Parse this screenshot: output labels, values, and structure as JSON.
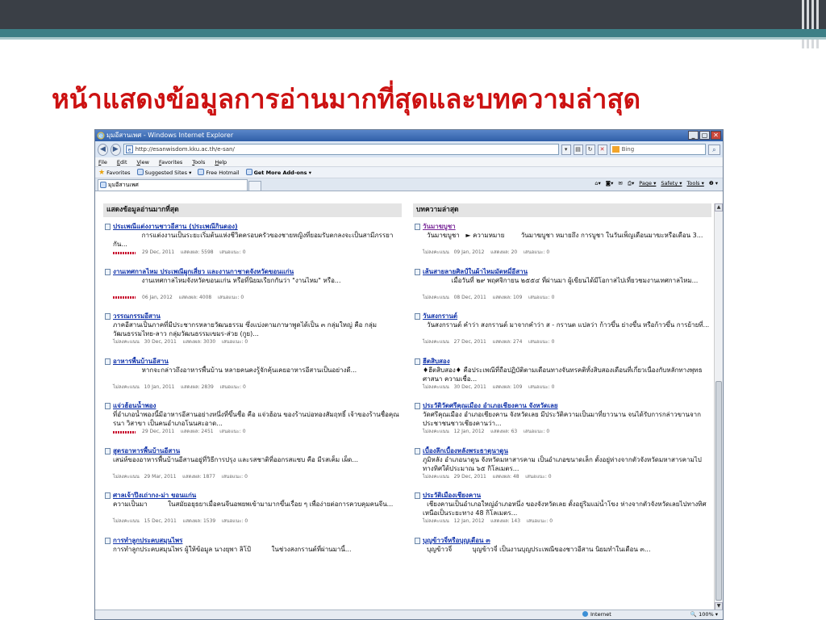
{
  "slide": {
    "title": "หน้าแสดงข้อมูลการอ่านมากที่สุดและบทความล่าสุด",
    "title_color": "#cc1111",
    "accent": "#3d7f86"
  },
  "browser": {
    "window_title": "มุมอีสานเพศ - Windows Internet Explorer",
    "address": "http://esanwisdom.kku.ac.th/e-san/",
    "search_placeholder": "Bing",
    "nav_back": "◀",
    "nav_forward": "▶",
    "menu": [
      "File",
      "Edit",
      "View",
      "Favorites",
      "Tools",
      "Help"
    ],
    "favorites": {
      "label": "Favorites",
      "suggested": "Suggested Sites ▾",
      "hotmail": "Free Hotmail",
      "addons": "Get More Add-ons ▾"
    },
    "tab_label": "มุมอีสานเพศ",
    "commands": {
      "page": "Page ▾",
      "safety": "Safety ▾",
      "tools": "Tools ▾",
      "help": "❷ ▾"
    },
    "status": {
      "zone": "Internet",
      "zoom": "100%"
    }
  },
  "left": {
    "header": "แสดงข้อมูลอ่านมากที่สุด",
    "items": [
      {
        "title": "ประเพณีแต่งงานชาวอีสาน (ประเพณีกินดอง)",
        "text": "              การแต่งงานเป็นระยะเริ่มต้นแห่งชีวิตครอบครัวของชายหญิงที่ยอมรับตกลงจะเป็นสามีภรรยากัน...",
        "meta": "29 Dec, 2011    แสดงผล: 5598    เสนอแนะ: 0",
        "rating": true
      },
      {
        "title": "งานเทศกาลไหม ประเพณีผูกเสี่ยว และงานกาชาดจังหวัดขอนแก่น",
        "text": "              งานเทศกาลไหมจังหวัดขอนแก่น หรือที่นิยมเรียกกันว่า \"งานไหม\" หรือ...",
        "meta": "06 Jan, 2012    แสดงผล: 4008    เสนอแนะ: 0",
        "rating": true
      },
      {
        "title": "วรรณกรรมอีสาน",
        "text": "ภาคอีสานเป็นภาคที่มีประชากรหลายวัฒนธรรม ซึ่งแบ่งตามภาษาพูดได้เป็น ๓ กลุ่มใหญ่ คือ กลุ่มวัฒนธรรมไทย-ลาว กลุ่มวัฒนธรรมเขมร-ส่วย (กูย)...",
        "meta": "ไม่ลงคะแนน   30 Dec, 2011    แสดงผล: 3030    เสนอแนะ: 0",
        "rating": false
      },
      {
        "title": "อาหารพื้นบ้านอีสาน",
        "text": "              หากจะกล่าวถึงอาหารพื้นบ้าน หลายคนคงรู้จักคุ้นเคยอาหารอีสานเป็นอย่างดี...",
        "meta": "ไม่ลงคะแนน   10 Jan, 2011    แสดงผล: 2839    เสนอแนะ: 0",
        "rating": false
      },
      {
        "title": "แจ่วฮ้อนน้ำพอง",
        "text": "ที่อำเภอน้ำพองนี้มีอาหารอีสานอย่างหนึ่งที่ขึ้นชื่อ คือ แจ่วฮ้อน ของร้านบ่อทองสัมฤทธิ์ เจ้าของร้านชื่อคุณรนา วิสาขา เป็นคนอำเภอโนนสะอาด...",
        "meta": "29 Dec, 2011    แสดงผล: 2451    เสนอแนะ: 0",
        "rating": true
      },
      {
        "title": "สูตรอาหารพื้นบ้านอีสาน",
        "text": "เสน่ห์ของอาหารพื้นบ้านอีสานอยู่ที่วิธีการปรุง และรสชาติที่ออกรสแซบ คือ มีรสเค็ม เผ็ด...",
        "meta": "ไม่ลงคะแนน   29 Mar, 2011    แสดงผล: 1877    เสนอแนะ: 0",
        "rating": false
      },
      {
        "title": "ศาลเจ้าปึงเถ่ากง-ม่า ขอนแก่น",
        "text": "ความเป็นมา          ในสมัยอยุธยาเมื่อคนจีนอพยพเข้ามามากขึ้นเรื่อย ๆ เพื่อง่ายต่อการควบคุมคนจีน...",
        "meta": "ไม่ลงคะแนน   15 Dec, 2011    แสดงผล: 1539    เสนอแนะ: 0",
        "rating": false
      },
      {
        "title": "การทำลูกประคบสมุนไพร",
        "text": "การทำลูกประคบสมุนไพร ผู้ให้ข้อมูล นางยุพา ลิโป้          ในช่วงสงกรานต์ที่ผ่านมานี้...",
        "meta": "",
        "rating": false
      }
    ]
  },
  "right": {
    "header": "บทความล่าสุด",
    "items": [
      {
        "title": "วันมาฆบูชา",
        "visited": true,
        "text": "  วันมาฆบูชา   ► ความหมาย        วันมาฆบูชา หมายถึง การบูชา ในวันเพ็ญเดือนมาฆะหรือเดือน 3...",
        "meta": "ไม่ลงคะแนน   09 Jan, 2012    แสดงผล: 20    เสนอแนะ: 0"
      },
      {
        "title": "เส้นสายลายศิลป์ในผ้าไหมมัดหมี่อีสาน",
        "visited": false,
        "text": "              เมื่อวันที่ ๒๙ พฤศจิกายน ๒๕๕๔ ที่ผ่านมา ผู้เขียนได้มีโอกาสไปเที่ยวชมงานเทศกาลไหม...",
        "meta": "ไม่ลงคะแนน   08 Dec, 2011    แสดงผล: 109    เสนอแนะ: 0"
      },
      {
        "title": "วันสงกรานต์",
        "visited": false,
        "text": "  วันสงกรานต์ คำว่า สงกรานต์ มาจากคำว่า ส - กรานต แปลว่า ก้าวขึ้น ย่างขึ้น หรือก้าวขึ้น การย้ายที่...",
        "meta": "ไม่ลงคะแนน   27 Dec, 2011    แสดงผล: 274    เสนอแนะ: 0"
      },
      {
        "title": "ฮีตสิบสอง",
        "visited": false,
        "text": "♦ฮีตสิบสอง♦ คือประเพณีที่ถือปฏิบัติตามเดือนทางจันทรคติทั้งสิบสองเดือนที่เกี่ยวเนื่องกับหลักทางพุทธศาสนา ความเชื่อ...",
        "meta": "ไม่ลงคะแนน   30 Dec, 2011    แสดงผล: 109    เสนอแนะ: 0"
      },
      {
        "title": "ประวัติวัดศรีคุณเมือง อำเภอเชียงคาน จังหวัดเลย",
        "visited": false,
        "text": "วัดศรีคุณเมือง อำเภอเชียงคาน จังหวัดเลย มีประวัติความเป็นมาที่ยาวนาน จนได้รับการกล่าวขานจากประชาชนชาวเชียงคานว่า...",
        "meta": "ไม่ลงคะแนน   12 Jan, 2012    แสดงผล: 63    เสนอแนะ: 0"
      },
      {
        "title": "เบื้องลึกเบื้องหลังพระธาตุนาดูน",
        "visited": false,
        "text": "ภูมิหลัง อำเภอนาดูน จังหวัดมหาสารคาม เป็นอำเภอขนาดเล็ก ตั้งอยู่ห่างจากตัวจังหวัดมหาสารคามไปทางทิศใต้ประมาณ ๖๕ กิโลเมตร...",
        "meta": "ไม่ลงคะแนน   29 Dec, 2011    แสดงผล: 48    เสนอแนะ: 0"
      },
      {
        "title": "ประวัติเมืองเชียงคาน",
        "visited": false,
        "text": "  เชียงคานเป็นอำเภอใหญ่อำเภอหนึ่ง ของจังหวัดเลย ตั้งอยู่ริมแม่น้ำโขง ห่างจากตัวจังหวัดเลยไปทางทิศเหนือเป็นระยะทาง 48 กิโลเมตร...",
        "meta": "ไม่ลงคะแนน   12 Jan, 2012    แสดงผล: 143    เสนอแนะ: 0"
      },
      {
        "title": "บุญข้าวจี่หรือบุญเดือน ๓",
        "visited": false,
        "text": "  บุญข้าวจี่          บุญข้าวจี่ เป็นงานบุญประเพณีของชาวอีสาน นิยมทำในเดือน ๓...",
        "meta": ""
      }
    ]
  }
}
